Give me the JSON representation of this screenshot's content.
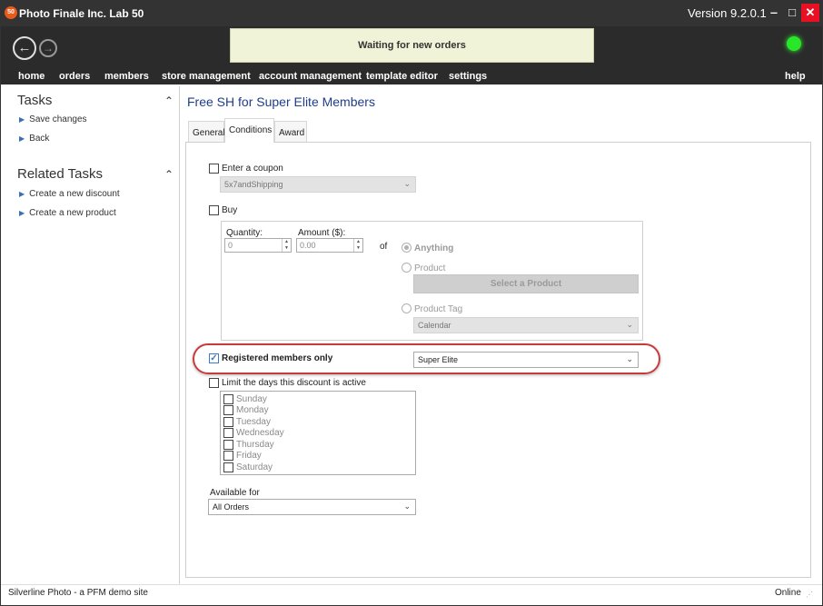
{
  "app": {
    "title": "Photo Finale Inc. Lab 50",
    "logo_text": "50",
    "version": "Version 9.2.0.1"
  },
  "window_controls": {
    "minimize": "‒",
    "maximize": "□",
    "close": "✕"
  },
  "header": {
    "back_icon": "←",
    "forward_icon": "→",
    "status": "Waiting for new orders",
    "status_led_color": "#29e629"
  },
  "menu": {
    "home": "home",
    "orders": "orders",
    "members": "members",
    "store_management": "store management",
    "account_management": "account management",
    "template_editor": "template editor",
    "settings": "settings",
    "help": "help"
  },
  "sidebar": {
    "tasks_title": "Tasks",
    "tasks": [
      "Save changes",
      "Back"
    ],
    "related_title": "Related Tasks",
    "related": [
      "Create a new discount",
      "Create a new product"
    ],
    "caret": "⌃"
  },
  "main": {
    "title": "Free SH for Super Elite Members",
    "tabs": [
      "General",
      "Conditions",
      "Award"
    ],
    "active_tab": "Conditions"
  },
  "conditions": {
    "coupon_label": "Enter a coupon",
    "coupon_value": "5x7andShipping",
    "buy_label": "Buy",
    "quantity_label": "Quantity:",
    "quantity_value": "0",
    "amount_label": "Amount ($):",
    "amount_value": "0.00",
    "of_label": "of",
    "anything_label": "Anything",
    "product_label": "Product",
    "select_product_button": "Select a Product",
    "product_tag_label": "Product Tag",
    "product_tag_value": "Calendar",
    "registered_label": "Registered members only",
    "registered_checked": true,
    "member_level": "Super Elite",
    "limit_days_label": "Limit the days this discount is active",
    "days": [
      "Sunday",
      "Monday",
      "Tuesday",
      "Wednesday",
      "Thursday",
      "Friday",
      "Saturday"
    ],
    "available_for_label": "Available for",
    "available_for_value": "All Orders",
    "dropdown_arrow": "⌄",
    "check_mark": "✓",
    "highlight_color": "#c73b3b"
  },
  "statusbar": {
    "site": "Silverline Photo - a PFM demo site",
    "connection": "Online"
  }
}
